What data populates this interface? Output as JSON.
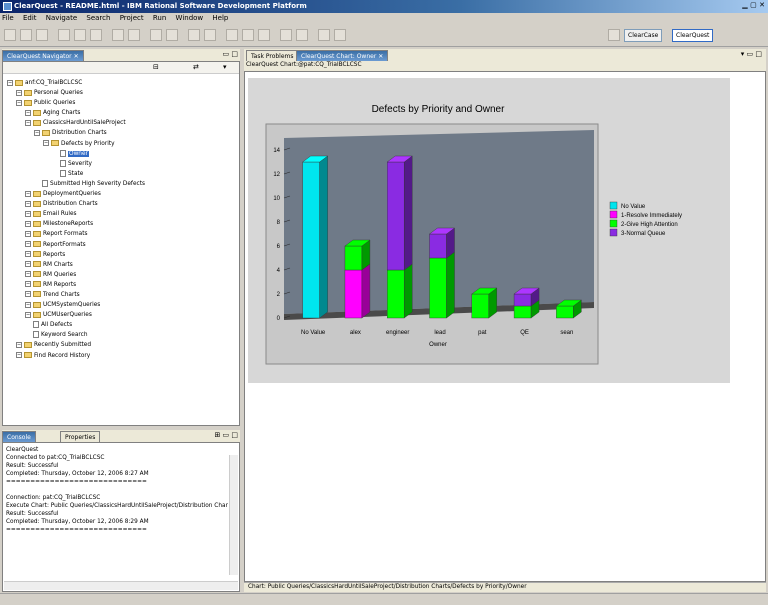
{
  "window": {
    "title": "ClearQuest - README.html - IBM Rational Software Development Platform"
  },
  "menu": [
    "File",
    "Edit",
    "Navigate",
    "Search",
    "Project",
    "Run",
    "Window",
    "Help"
  ],
  "perspectives": [
    "ClearCase",
    "ClearQuest"
  ],
  "navigator": {
    "tab": "ClearQuest Navigator",
    "tree": [
      {
        "label": "anf:CQ_TrialBCLCSC",
        "depth": 0,
        "icon": "db"
      },
      {
        "label": "Personal Queries",
        "depth": 1,
        "icon": "folder"
      },
      {
        "label": "Public Queries",
        "depth": 1,
        "icon": "folder"
      },
      {
        "label": "Aging Charts",
        "depth": 2,
        "icon": "folder"
      },
      {
        "label": "ClassicsHardUntilSaleProject",
        "depth": 2,
        "icon": "folder"
      },
      {
        "label": "Distribution Charts",
        "depth": 3,
        "icon": "folder"
      },
      {
        "label": "Defects by Priority",
        "depth": 4,
        "icon": "folder"
      },
      {
        "label": "Owner",
        "depth": 5,
        "icon": "doc",
        "selected": true
      },
      {
        "label": "Severity",
        "depth": 5,
        "icon": "doc"
      },
      {
        "label": "State",
        "depth": 5,
        "icon": "doc"
      },
      {
        "label": "Submitted High Severity Defects",
        "depth": 3,
        "icon": "doc"
      },
      {
        "label": "DeploymentQueries",
        "depth": 2,
        "icon": "folder"
      },
      {
        "label": "Distribution Charts",
        "depth": 2,
        "icon": "folder"
      },
      {
        "label": "Email Rules",
        "depth": 2,
        "icon": "folder"
      },
      {
        "label": "MilestoneReports",
        "depth": 2,
        "icon": "folder"
      },
      {
        "label": "Report Formats",
        "depth": 2,
        "icon": "folder"
      },
      {
        "label": "ReportFormats",
        "depth": 2,
        "icon": "folder"
      },
      {
        "label": "Reports",
        "depth": 2,
        "icon": "folder"
      },
      {
        "label": "RM Charts",
        "depth": 2,
        "icon": "folder"
      },
      {
        "label": "RM Queries",
        "depth": 2,
        "icon": "folder"
      },
      {
        "label": "RM Reports",
        "depth": 2,
        "icon": "folder"
      },
      {
        "label": "Trend Charts",
        "depth": 2,
        "icon": "folder"
      },
      {
        "label": "UCMSystemQueries",
        "depth": 2,
        "icon": "folder"
      },
      {
        "label": "UCMUserQueries",
        "depth": 2,
        "icon": "folder"
      },
      {
        "label": "All Defects",
        "depth": 2,
        "icon": "doc"
      },
      {
        "label": "Keyword Search",
        "depth": 2,
        "icon": "doc"
      },
      {
        "label": "Recently Submitted",
        "depth": 1,
        "icon": "folder"
      },
      {
        "label": "Find Record History",
        "depth": 1,
        "icon": "folder"
      }
    ]
  },
  "console": {
    "tabs": [
      "Console",
      "Properties"
    ],
    "header": "ClearQuest",
    "lines": [
      "Connected to pat:CQ_TrialBCLCSC",
      "Result: Successful",
      "Completed: Thursday, October 12, 2006 8:27 AM",
      "=============================",
      "",
      "Connection: pat:CQ_TrialBCLCSC",
      "Execute Chart: Public Queries/ClassicsHardUntilSaleProject/Distribution Char",
      "Result: Successful",
      "Completed: Thursday, October 12, 2006 8:29 AM",
      "============================="
    ]
  },
  "editor": {
    "tabs": [
      "Task Problems",
      "ClearQuest Chart: Owner"
    ],
    "breadcrumb": "ClearQuest Chart:@pat:CQ_TrialBCLCSC",
    "status": "Chart: Public Queries/ClassicsHardUntilSaleProject/Distribution Charts/Defects by Priority/Owner"
  },
  "colors": {
    "no_value": "#00e5ee",
    "resolve": "#ff00ff",
    "give": "#00ff00",
    "normal": "#8a2be2"
  },
  "chart_data": {
    "type": "bar",
    "stacked": true,
    "title": "Defects by Priority and Owner",
    "xlabel": "Owner",
    "ylabel": "",
    "ylim": [
      0,
      14
    ],
    "yticks": [
      0,
      2,
      4,
      6,
      8,
      10,
      12,
      14
    ],
    "categories": [
      "No Value",
      "alex",
      "engineer",
      "lead",
      "pat",
      "QE",
      "sean"
    ],
    "series": [
      {
        "name": "No Value",
        "values": [
          13,
          0,
          0,
          0,
          0,
          0,
          0
        ]
      },
      {
        "name": "1-Resolve Immediately",
        "values": [
          0,
          4,
          0,
          0,
          0,
          0,
          0
        ]
      },
      {
        "name": "2-Give High Attention",
        "values": [
          0,
          2,
          4,
          5,
          2,
          1,
          1
        ]
      },
      {
        "name": "3-Normal Queue",
        "values": [
          0,
          0,
          9,
          2,
          0,
          1,
          0
        ]
      }
    ],
    "legend_position": "right"
  }
}
